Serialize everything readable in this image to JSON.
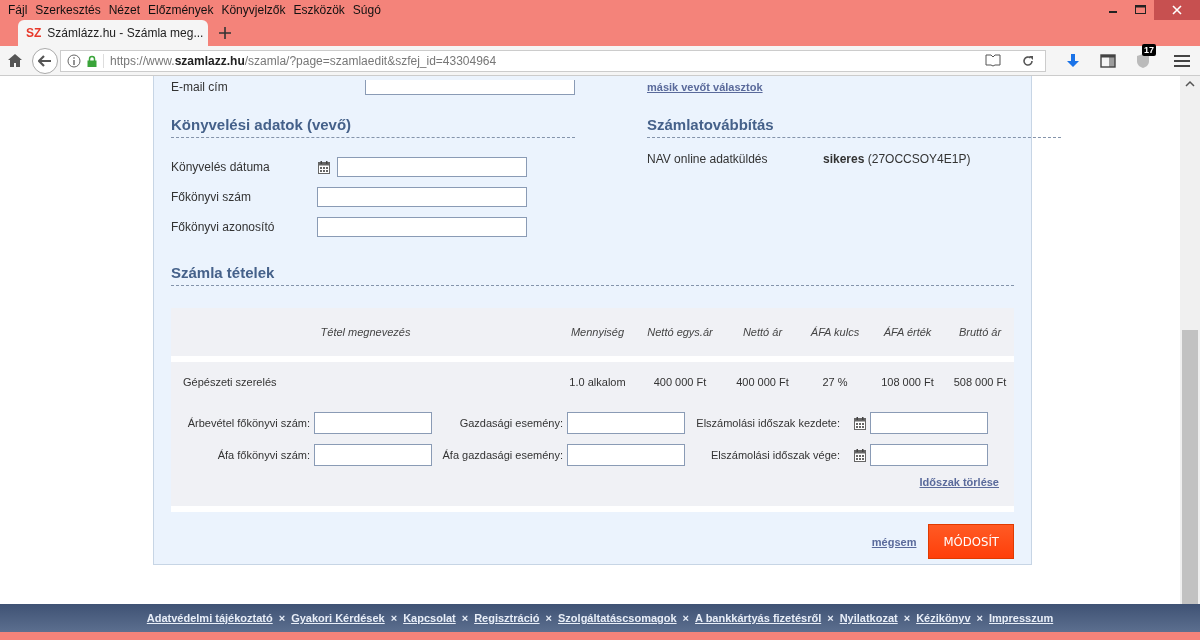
{
  "menu": [
    "Fájl",
    "Szerkesztés",
    "Nézet",
    "Előzmények",
    "Könyvjelzők",
    "Eszközök",
    "Súgó"
  ],
  "tabs": [
    {
      "favicon": "SZ",
      "title": "Számlázz.hu - Számla meg...",
      "selected": true
    }
  ],
  "address_bar": {
    "url": "https://www.**szamlazz.hu**/szamla/?page=szamlaedit&szfej_id=43304964"
  },
  "toolbar": {
    "badge": "17"
  },
  "top_row": {
    "label": "E-mail cím",
    "link": "másik vevőt választok"
  },
  "accounting": {
    "title": "Könyvelési adatok (vevő)",
    "fields": [
      {
        "label": "Könyvelés dátuma",
        "kind": "date"
      },
      {
        "label": "Főkönyvi szám",
        "kind": "text"
      },
      {
        "label": "Főkönyvi azonosító",
        "kind": "text"
      }
    ]
  },
  "forwarding": {
    "title": "Számlatovábbítás",
    "rows": [
      {
        "label": "NAV online adatküldés",
        "value": "**sikeres** (27OCCSOY4E1P)"
      }
    ]
  },
  "items": {
    "title": "Számla tételek",
    "columns": [
      "Tétel megnevezés",
      "Mennyiség",
      "Nettó egys.ár",
      "Nettó ár",
      "ÁFA kulcs",
      "ÁFA érték",
      "Bruttó ár"
    ],
    "rows": [
      {
        "cells": [
          "Gépészeti szerelés",
          "1.0 alkalom",
          "400 000 Ft",
          "400 000 Ft",
          "27 %",
          "108 000 Ft",
          "508 000 Ft"
        ]
      }
    ],
    "fields": [
      {
        "label": "Árbevétel főkönyvi szám:",
        "kind": "text"
      },
      {
        "label": "Gazdasági esemény:",
        "kind": "text"
      },
      {
        "label": "Elszámolási időszak kezdete:",
        "kind": "date"
      },
      {
        "label": "Áfa főkönyvi szám:",
        "kind": "text"
      },
      {
        "label": "Áfa gazdasági esemény:",
        "kind": "text"
      },
      {
        "label": "Elszámolási időszak vége:",
        "kind": "date"
      }
    ],
    "clear_link": "Időszak törlése"
  },
  "actions": {
    "cancel": "mégsem",
    "submit": "MÓDOSÍT"
  },
  "footer": {
    "links": [
      "Adatvédelmi tájékoztató",
      "Gyakori Kérdések",
      "Kapcsolat",
      "Regisztráció",
      "Szolgáltatáscsomagok",
      "A bankkártyás fizetésről",
      "Nyilatkozat",
      "Kézikönyv",
      "Impresszum"
    ],
    "separators": [
      "×",
      "×",
      "×",
      "×",
      "×",
      "×",
      "×",
      "×"
    ]
  }
}
